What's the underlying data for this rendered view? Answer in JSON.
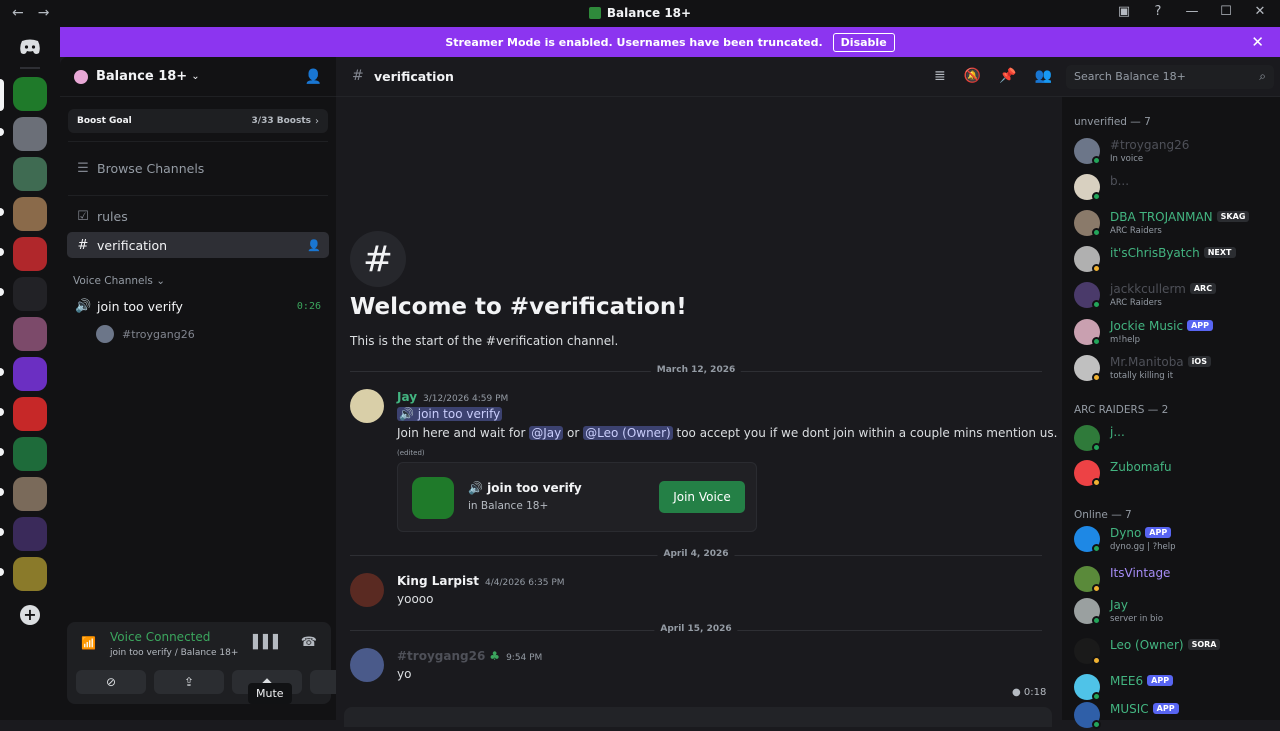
{
  "titlebar": {
    "title": "Balance 18+"
  },
  "banner": {
    "text": "Streamer Mode is enabled. Usernames have been truncated.",
    "button": "Disable"
  },
  "server": {
    "name": "Balance 18+",
    "boost_label": "Boost Goal",
    "boost_count": "3/33 Boosts",
    "browse": "Browse Channels",
    "channels": [
      {
        "label": "rules"
      },
      {
        "label": "verification"
      }
    ],
    "voice_category": "Voice Channels",
    "voice_channel": {
      "label": "join too verify",
      "timer": "0:26"
    },
    "voice_user": "#troygang26"
  },
  "voice_panel": {
    "status": "Voice Connected",
    "location": "join too verify / Balance 18+",
    "tooltip": "Mute"
  },
  "channel_header": {
    "name": "verification",
    "search_placeholder": "Search Balance 18+"
  },
  "welcome": {
    "title": "Welcome to #verification!",
    "subtitle": "This is the start of the #verification channel."
  },
  "messages": {
    "date1": "March 12, 2026",
    "m1": {
      "author": "Jay",
      "time": "3/12/2026 4:59 PM",
      "link": "🔊 join too verify",
      "text_a": "Join here and wait for ",
      "mention_a": "@Jay",
      "text_b": " or ",
      "mention_b": "@Leo (Owner)",
      "text_c": " too accept you if we dont join within a couple mins mention us.",
      "edited": "(edited)",
      "embed_title": "join too verify",
      "embed_sub": "in Balance 18+",
      "embed_button": "Join Voice"
    },
    "date2": "April 4, 2026",
    "m2": {
      "author": "King Larpist",
      "time": "4/4/2026 6:35 PM",
      "text": "yoooo"
    },
    "date3": "April 15, 2026",
    "m3": {
      "author": "#troygang26",
      "time": "9:54 PM",
      "text": "yo",
      "voice_length": "0:18"
    }
  },
  "members": {
    "groups": [
      {
        "title": "unverified — 7"
      },
      {
        "title": "ARC RAIDERS — 2"
      },
      {
        "title": "Online — 7"
      }
    ],
    "list": [
      {
        "name": "#troygang26",
        "status": "In voice",
        "tag": "",
        "color": "#4e5058",
        "status_color": "#23a55a"
      },
      {
        "name": "b...",
        "status": "",
        "tag": "",
        "color": "#4e5058",
        "status_color": "#23a55a"
      },
      {
        "name": "DBA TROJANMAN",
        "status": "ARC Raiders",
        "tag": "SKAG",
        "color": "#43b581",
        "status_color": "#23a55a"
      },
      {
        "name": "it'sChrisByatch",
        "status": "",
        "tag": "NEXT",
        "color": "#43b581",
        "status_color": "#f0b232"
      },
      {
        "name": "jackkcullerm",
        "status": "ARC Raiders",
        "tag": "ARC",
        "color": "#4e5058",
        "status_color": "#23a55a"
      },
      {
        "name": "Jockie Music",
        "status": "m!help",
        "tag": "APP",
        "color": "#43b581",
        "status_color": "#23a55a"
      },
      {
        "name": "Mr.Manitoba",
        "status": "totally killing it",
        "tag": "iOS",
        "color": "#4e5058",
        "status_color": "#f0b232"
      },
      {
        "name": "j...",
        "status": "",
        "tag": "",
        "color": "#43b581",
        "status_color": "#23a55a"
      },
      {
        "name": "Zubomafu",
        "status": "",
        "tag": "",
        "color": "#43b581",
        "status_color": "#f0b232"
      },
      {
        "name": "Dyno",
        "status": "dyno.gg | ?help",
        "tag": "APP",
        "color": "#43b581",
        "status_color": "#23a55a"
      },
      {
        "name": "ItsVintage",
        "status": "",
        "tag": "",
        "color": "#a58cf5",
        "status_color": "#f0b232"
      },
      {
        "name": "Jay",
        "status": "server in bio",
        "tag": "",
        "color": "#43b581",
        "status_color": "#23a55a"
      },
      {
        "name": "Leo (Owner)",
        "status": "",
        "tag": "SORA",
        "color": "#43b581",
        "status_color": "#f0b232"
      },
      {
        "name": "MEE6",
        "status": "",
        "tag": "APP",
        "color": "#43b581",
        "status_color": "#23a55a"
      },
      {
        "name": "MUSIC",
        "status": "",
        "tag": "APP",
        "color": "#43b581",
        "status_color": "#23a55a"
      }
    ]
  }
}
